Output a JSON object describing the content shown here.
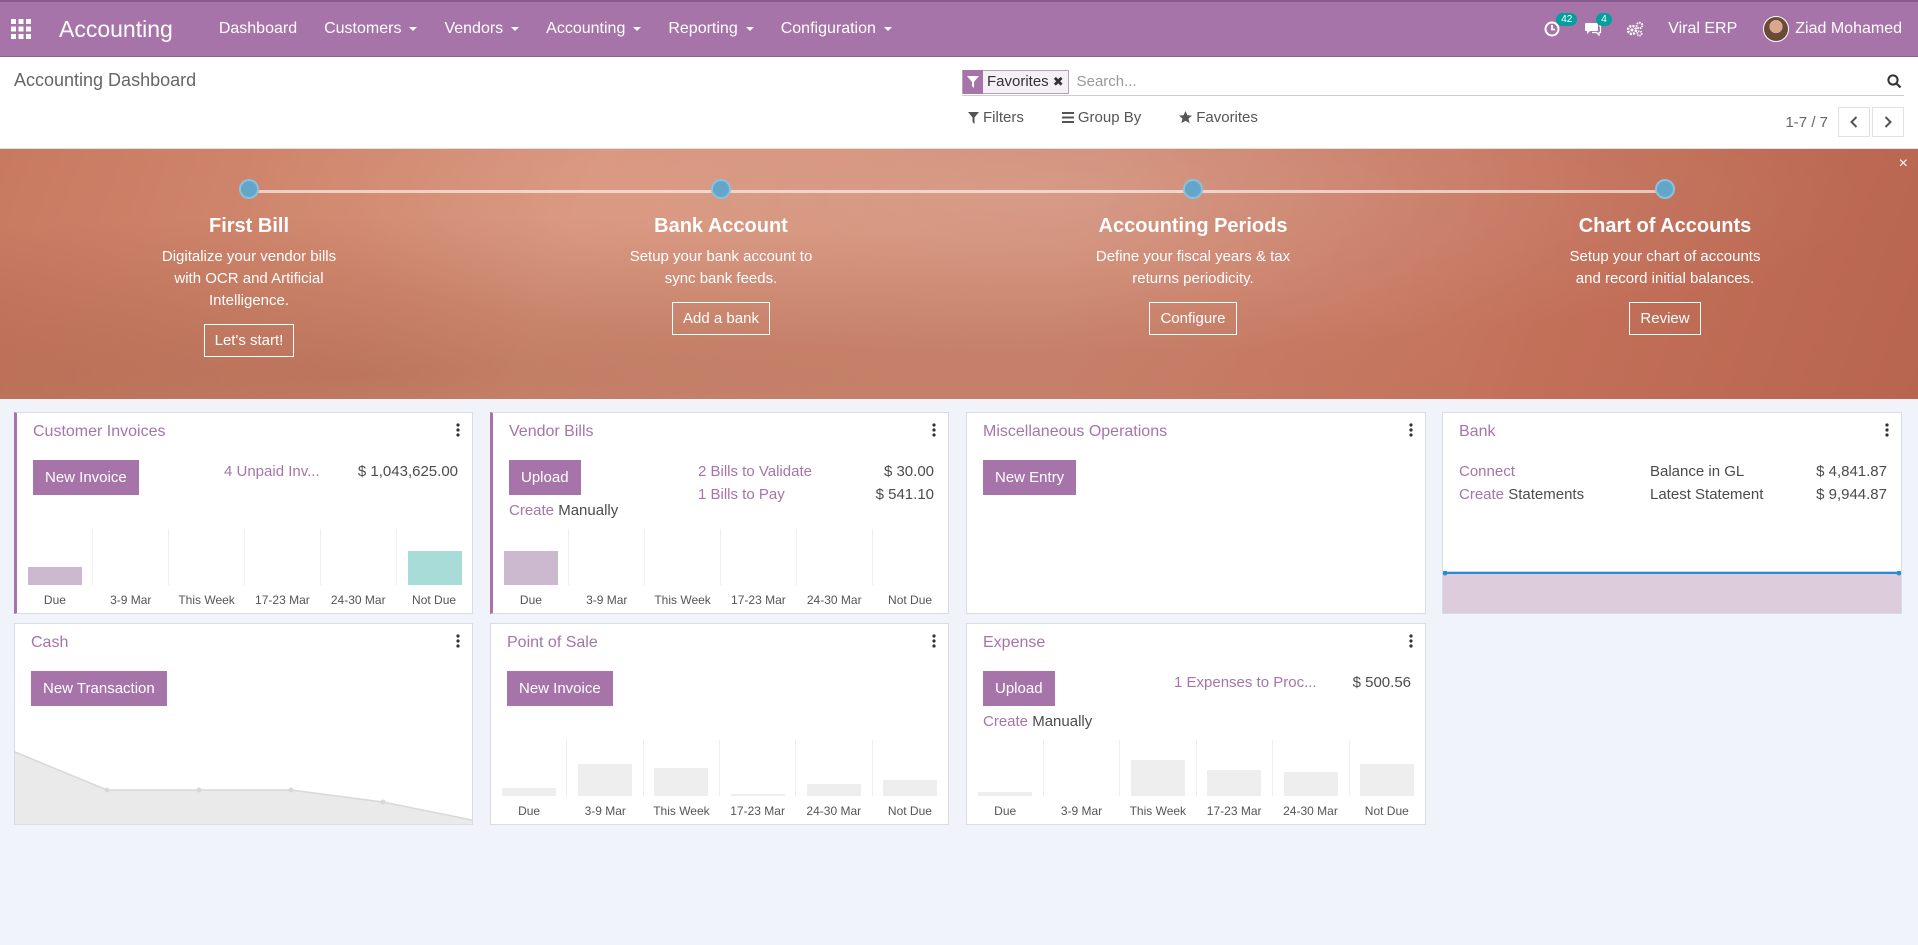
{
  "navbar": {
    "app_name": "Accounting",
    "menu": [
      "Dashboard",
      "Customers",
      "Vendors",
      "Accounting",
      "Reporting",
      "Configuration"
    ],
    "activity_badge": "42",
    "messages_badge": "4",
    "company": "Viral ERP",
    "user": "Ziad Mohamed"
  },
  "control_panel": {
    "breadcrumb": "Accounting Dashboard",
    "search": {
      "facet_value": "Favorites",
      "placeholder": "Search..."
    },
    "filters_label": "Filters",
    "groupby_label": "Group By",
    "favorites_label": "Favorites",
    "pager": "1-7 / 7"
  },
  "banner": {
    "close_glyph": "×",
    "steps": [
      {
        "title": "First Bill",
        "desc": "Digitalize your vendor bills with OCR and Artificial Intelligence.",
        "button": "Let's start!"
      },
      {
        "title": "Bank Account",
        "desc": "Setup your bank account to sync bank feeds.",
        "button": "Add a bank"
      },
      {
        "title": "Accounting Periods",
        "desc": "Define your fiscal years & tax returns periodicity.",
        "button": "Configure"
      },
      {
        "title": "Chart of Accounts",
        "desc": "Setup your chart of accounts and record initial balances.",
        "button": "Review"
      }
    ]
  },
  "chart_labels": [
    "Due",
    "3-9 Mar",
    "This Week",
    "17-23 Mar",
    "24-30 Mar",
    "Not Due"
  ],
  "cards": {
    "customer_invoices": {
      "title": "Customer Invoices",
      "button": "New Invoice",
      "unpaid_label": "4 Unpaid Inv...",
      "unpaid_amount": "$ 1,043,625.00",
      "bar_values": [
        0.32,
        0,
        0,
        0,
        0,
        0.6
      ],
      "bar_colors": [
        "#cdb9cf",
        "#eeeeee",
        "#eeeeee",
        "#eeeeee",
        "#eeeeee",
        "#a8dcd9"
      ]
    },
    "vendor_bills": {
      "title": "Vendor Bills",
      "button": "Upload",
      "validate_label": "2 Bills to Validate",
      "validate_amount": "$ 30.00",
      "pay_label": "1 Bills to Pay",
      "pay_amount": "$ 541.10",
      "create_link": "Create",
      "create_text": "Manually",
      "bar_values": [
        0.6,
        0,
        0,
        0,
        0,
        0
      ],
      "bar_colors": [
        "#cdb9cf",
        "#eeeeee",
        "#eeeeee",
        "#eeeeee",
        "#eeeeee",
        "#eeeeee"
      ]
    },
    "misc": {
      "title": "Miscellaneous Operations",
      "button": "New Entry"
    },
    "bank": {
      "title": "Bank",
      "connect_link": "Connect",
      "create_link": "Create",
      "create_text": "Statements",
      "gl_label": "Balance in GL",
      "gl_amount": "$ 4,841.87",
      "latest_label": "Latest Statement",
      "latest_amount": "$ 9,944.87"
    },
    "cash": {
      "title": "Cash",
      "button": "New Transaction"
    },
    "pos": {
      "title": "Point of Sale",
      "button": "New Invoice",
      "bar_values": [
        0.14,
        0.58,
        0.5,
        0.04,
        0.22,
        0.28
      ],
      "bar_colors": [
        "#eeeeee",
        "#eeeeee",
        "#eeeeee",
        "#eeeeee",
        "#eeeeee",
        "#eeeeee"
      ]
    },
    "expense": {
      "title": "Expense",
      "button": "Upload",
      "expenses_label": "1 Expenses to Proc...",
      "expenses_amount": "$ 500.56",
      "create_link": "Create",
      "create_text": "Manually",
      "bar_values": [
        0.07,
        0,
        0.64,
        0.46,
        0.42,
        0.58
      ],
      "bar_colors": [
        "#eeeeee",
        "#eeeeee",
        "#eeeeee",
        "#eeeeee",
        "#eeeeee",
        "#eeeeee"
      ]
    }
  }
}
